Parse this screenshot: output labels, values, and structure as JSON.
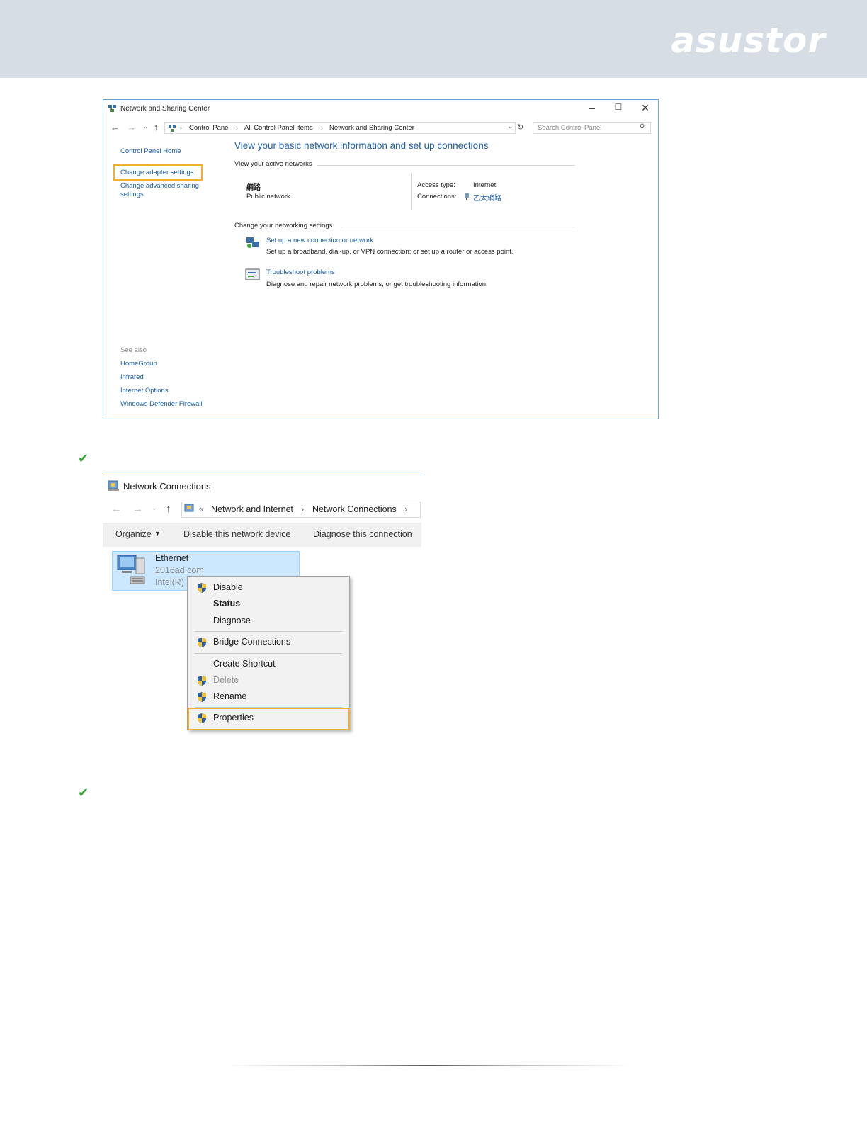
{
  "brand": {
    "logo_text": "asustor",
    "header_color": "#d6dde4"
  },
  "window1": {
    "title": "Network and Sharing Center",
    "breadcrumb": [
      "Control Panel",
      "All Control Panel Items",
      "Network and Sharing Center"
    ],
    "search_placeholder": "Search Control Panel",
    "sidebar": {
      "home": "Control Panel Home",
      "change_adapter": "Change adapter settings",
      "change_sharing_line1": "Change advanced sharing",
      "change_sharing_line2": "settings",
      "see_also": "See also",
      "see_also_items": [
        "HomeGroup",
        "Infrared",
        "Internet Options",
        "Windows Defender Firewall"
      ]
    },
    "main": {
      "heading": "View your basic network information and set up connections",
      "active_networks_label": "View your active networks",
      "network_name": "網路",
      "network_type": "Public network",
      "access_type_label": "Access type:",
      "access_type_value": "Internet",
      "connections_label": "Connections:",
      "connections_value": "乙太網路",
      "change_settings_label": "Change your networking settings",
      "setup_link": "Set up a new connection or network",
      "setup_desc": "Set up a broadband, dial-up, or VPN connection; or set up a router or access point.",
      "troubleshoot_link": "Troubleshoot problems",
      "troubleshoot_desc": "Diagnose and repair network problems, or get troubleshooting information."
    }
  },
  "window2": {
    "title": "Network Connections",
    "breadcrumb": [
      "Network and Internet",
      "Network Connections"
    ],
    "toolbar": {
      "organize": "Organize",
      "disable": "Disable this network device",
      "diagnose": "Diagnose this connection"
    },
    "adapter": {
      "name": "Ethernet",
      "domain": "2016ad.com",
      "device": "Intel(R) I"
    },
    "context_menu": {
      "disable": "Disable",
      "status": "Status",
      "diagnose": "Diagnose",
      "bridge": "Bridge Connections",
      "shortcut": "Create Shortcut",
      "delete": "Delete",
      "rename": "Rename",
      "properties": "Properties"
    }
  },
  "colors": {
    "highlight": "#f0b030",
    "link": "#1a5ba6",
    "check": "#3aa635"
  }
}
